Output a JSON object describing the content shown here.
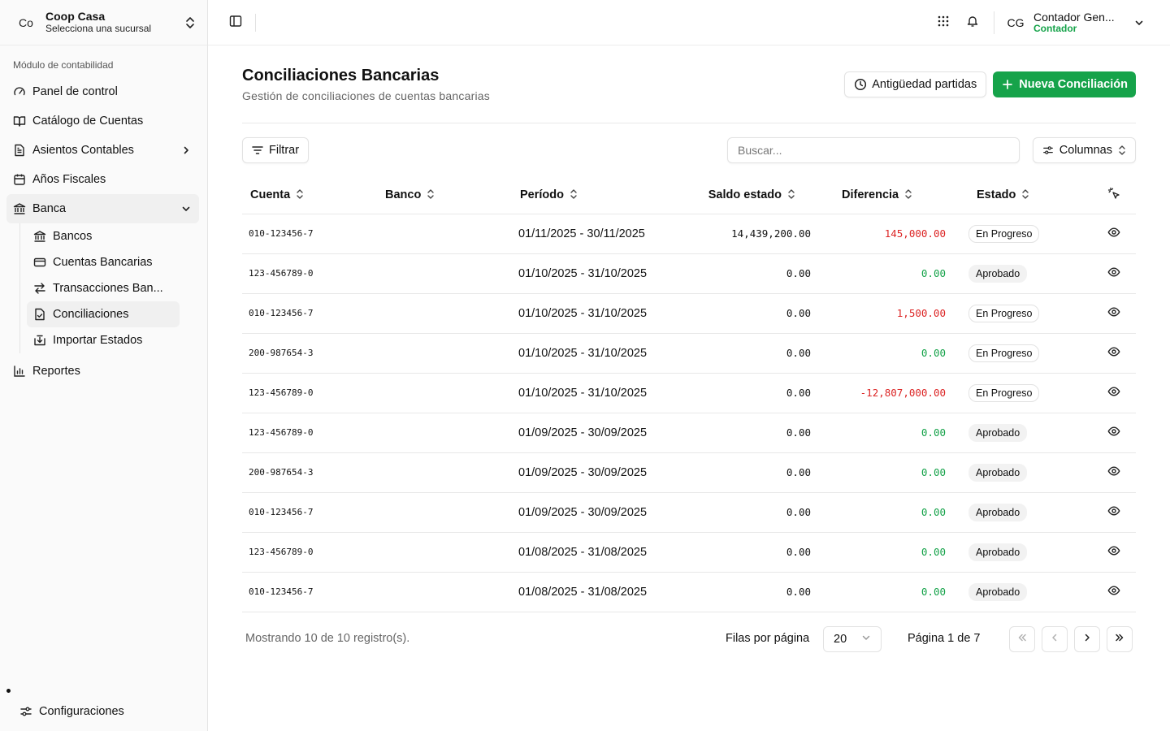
{
  "org": {
    "initials": "Co",
    "name": "Coop Casa",
    "subtitle": "Selecciona una sucursal"
  },
  "sidebar": {
    "section_label": "Módulo de contabilidad",
    "items": [
      {
        "label": "Panel de control",
        "icon": "gauge-icon"
      },
      {
        "label": "Catálogo de Cuentas",
        "icon": "book-open-icon"
      },
      {
        "label": "Asientos Contables",
        "icon": "document-icon"
      },
      {
        "label": "Años Fiscales",
        "icon": "calendar-icon"
      },
      {
        "label": "Banca",
        "icon": "bank-icon"
      }
    ],
    "banca_sub": [
      {
        "label": "Bancos",
        "icon": "bank-icon"
      },
      {
        "label": "Cuentas Bancarias",
        "icon": "credit-card-icon"
      },
      {
        "label": "Transacciones Ban...",
        "icon": "transfer-arrows-icon"
      },
      {
        "label": "Conciliaciones",
        "icon": "file-check-icon"
      },
      {
        "label": "Importar Estados",
        "icon": "import-icon"
      }
    ],
    "reportes": "Reportes",
    "configuraciones": "Configuraciones"
  },
  "user": {
    "initials": "CG",
    "name": "Contador Gen...",
    "role": "Contador"
  },
  "page": {
    "title": "Conciliaciones Bancarias",
    "subtitle": "Gestión de conciliaciones de cuentas bancarias",
    "antiguedad_label": "Antigüedad partidas",
    "nueva_label": "Nueva Conciliación"
  },
  "toolbar": {
    "filter_label": "Filtrar",
    "search_placeholder": "Buscar...",
    "columns_label": "Columnas"
  },
  "table": {
    "headers": {
      "cuenta": "Cuenta",
      "banco": "Banco",
      "periodo": "Período",
      "saldo": "Saldo estado",
      "diferencia": "Diferencia",
      "estado": "Estado"
    },
    "rows": [
      {
        "cuenta": "010-123456-7",
        "banco": "",
        "periodo": "01/11/2025 - 30/11/2025",
        "saldo": "14,439,200.00",
        "diferencia": "145,000.00",
        "dif_state": "neg",
        "estado": "En Progreso",
        "estado_kind": "prog"
      },
      {
        "cuenta": "123-456789-0",
        "banco": "",
        "periodo": "01/10/2025 - 31/10/2025",
        "saldo": "0.00",
        "diferencia": "0.00",
        "dif_state": "zero",
        "estado": "Aprobado",
        "estado_kind": "ok"
      },
      {
        "cuenta": "010-123456-7",
        "banco": "",
        "periodo": "01/10/2025 - 31/10/2025",
        "saldo": "0.00",
        "diferencia": "1,500.00",
        "dif_state": "neg",
        "estado": "En Progreso",
        "estado_kind": "prog"
      },
      {
        "cuenta": "200-987654-3",
        "banco": "",
        "periodo": "01/10/2025 - 31/10/2025",
        "saldo": "0.00",
        "diferencia": "0.00",
        "dif_state": "zero",
        "estado": "En Progreso",
        "estado_kind": "prog"
      },
      {
        "cuenta": "123-456789-0",
        "banco": "",
        "periodo": "01/10/2025 - 31/10/2025",
        "saldo": "0.00",
        "diferencia": "-12,807,000.00",
        "dif_state": "neg",
        "estado": "En Progreso",
        "estado_kind": "prog"
      },
      {
        "cuenta": "123-456789-0",
        "banco": "",
        "periodo": "01/09/2025 - 30/09/2025",
        "saldo": "0.00",
        "diferencia": "0.00",
        "dif_state": "zero",
        "estado": "Aprobado",
        "estado_kind": "ok"
      },
      {
        "cuenta": "200-987654-3",
        "banco": "",
        "periodo": "01/09/2025 - 30/09/2025",
        "saldo": "0.00",
        "diferencia": "0.00",
        "dif_state": "zero",
        "estado": "Aprobado",
        "estado_kind": "ok"
      },
      {
        "cuenta": "010-123456-7",
        "banco": "",
        "periodo": "01/09/2025 - 30/09/2025",
        "saldo": "0.00",
        "diferencia": "0.00",
        "dif_state": "zero",
        "estado": "Aprobado",
        "estado_kind": "ok"
      },
      {
        "cuenta": "123-456789-0",
        "banco": "",
        "periodo": "01/08/2025 - 31/08/2025",
        "saldo": "0.00",
        "diferencia": "0.00",
        "dif_state": "zero",
        "estado": "Aprobado",
        "estado_kind": "ok"
      },
      {
        "cuenta": "010-123456-7",
        "banco": "",
        "periodo": "01/08/2025 - 31/08/2025",
        "saldo": "0.00",
        "diferencia": "0.00",
        "dif_state": "zero",
        "estado": "Aprobado",
        "estado_kind": "ok"
      }
    ]
  },
  "footer": {
    "showing": "Mostrando 10 de 10 registro(s).",
    "rows_label": "Filas por página",
    "rows_value": "20",
    "page_info": "Página 1 de 7"
  },
  "colors": {
    "accent": "#16a34a",
    "negative": "#dc2626",
    "sidebar_bg": "#fafafa",
    "border": "#e5e5e5"
  }
}
